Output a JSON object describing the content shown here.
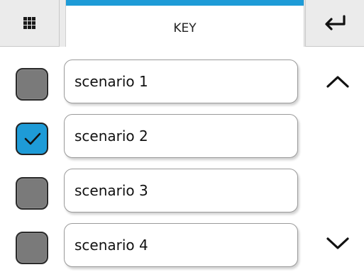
{
  "header": {
    "title": "KEY",
    "menu_icon": "grid-icon",
    "enter_icon": "return-arrow-icon",
    "accent_color": "#1e9bd7"
  },
  "scenarios": [
    {
      "label": "scenario 1",
      "checked": false
    },
    {
      "label": "scenario 2",
      "checked": true
    },
    {
      "label": "scenario 3",
      "checked": false
    },
    {
      "label": "scenario 4",
      "checked": false
    }
  ],
  "scroll": {
    "up_icon": "chevron-up-icon",
    "down_icon": "chevron-down-icon"
  },
  "colors": {
    "checked": "#1e9bd7",
    "unchecked": "#7a7a7a"
  }
}
